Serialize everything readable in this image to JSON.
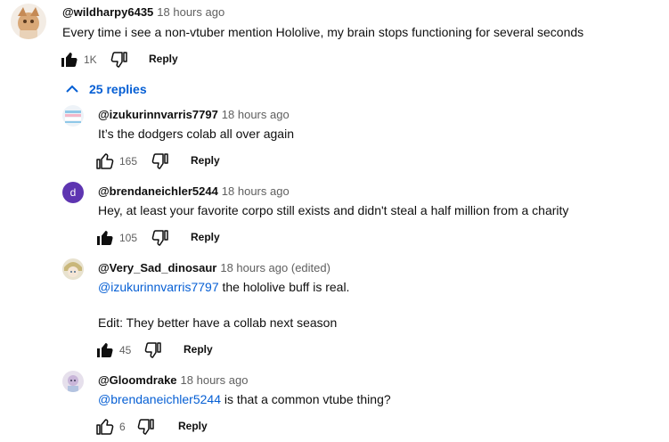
{
  "top_comment": {
    "author": "@wildharpy6435",
    "time": "18 hours ago",
    "text": "Every time i see a non-vtuber mention Hololive, my brain stops functioning for several seconds",
    "likes": "1K",
    "reply_label": "Reply",
    "liked": true
  },
  "replies_toggle": {
    "label": "25 replies"
  },
  "replies": [
    {
      "author": "@izukurinnvarris7797",
      "time": "18 hours ago",
      "text": "It’s the dodgers colab all over again",
      "likes": "165",
      "reply_label": "Reply"
    },
    {
      "author": "@brendaneichler5244",
      "time": "18 hours ago",
      "avatar_letter": "d",
      "text": "Hey, at least your favorite corpo still exists and didn't steal a half million from a charity",
      "likes": "105",
      "reply_label": "Reply"
    },
    {
      "author": "@Very_Sad_dinosaur",
      "time": "18 hours ago (edited)",
      "mention": "@izukurinnvarris7797",
      "text": " the hololive buff is real.",
      "text2": "Edit: They better have a collab next season",
      "likes": "45",
      "reply_label": "Reply"
    },
    {
      "author": "@Gloomdrake",
      "time": "18 hours ago",
      "mention": "@brendaneichler5244",
      "text": " is that a common vtube thing?",
      "likes": "6",
      "reply_label": "Reply"
    }
  ],
  "colors": {
    "link": "#065fd4",
    "secondary": "#606060",
    "avatar_purple": "#5e35b1"
  }
}
